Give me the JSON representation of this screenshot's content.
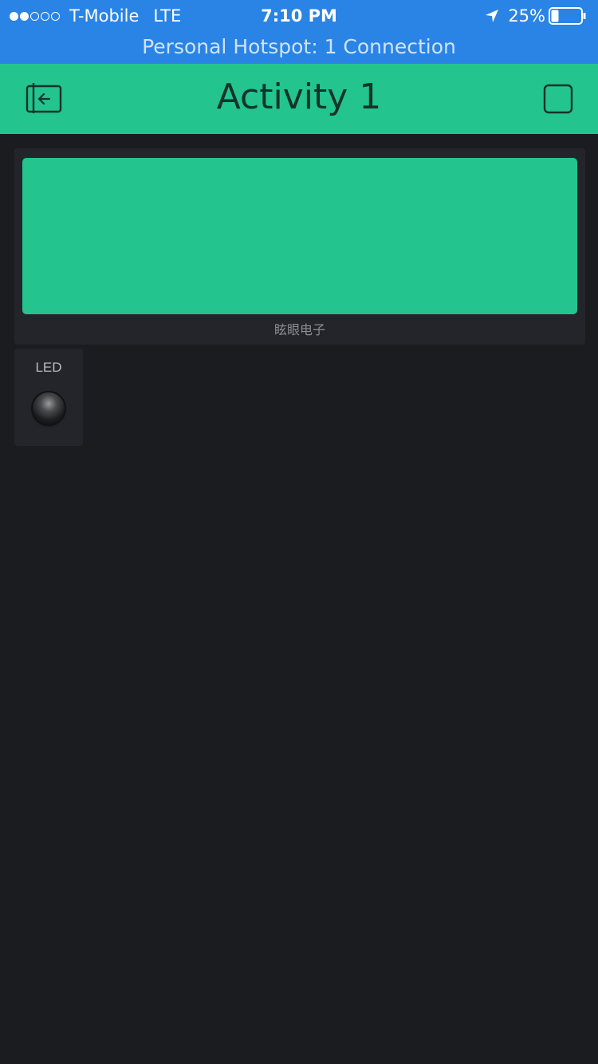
{
  "status_bar": {
    "carrier": "T-Mobile",
    "network": "LTE",
    "time": "7:10 PM",
    "battery_percent_text": "25%",
    "battery_level": 0.25,
    "signal_bars_filled": 2,
    "signal_bars_total": 5
  },
  "hotspot_banner": {
    "text": "Personal Hotspot: 1 Connection"
  },
  "header": {
    "title": "Activity 1",
    "back_icon": "exit-project-icon",
    "stop_icon": "stop-square-icon"
  },
  "widgets": {
    "display": {
      "label": "眩眼电子",
      "color": "#23c48e"
    },
    "led": {
      "label": "LED",
      "state": "off"
    }
  },
  "colors": {
    "status_bar": "#2a84e6",
    "accent": "#23c48e",
    "background": "#1b1c20",
    "widget_bg": "#24252b"
  }
}
